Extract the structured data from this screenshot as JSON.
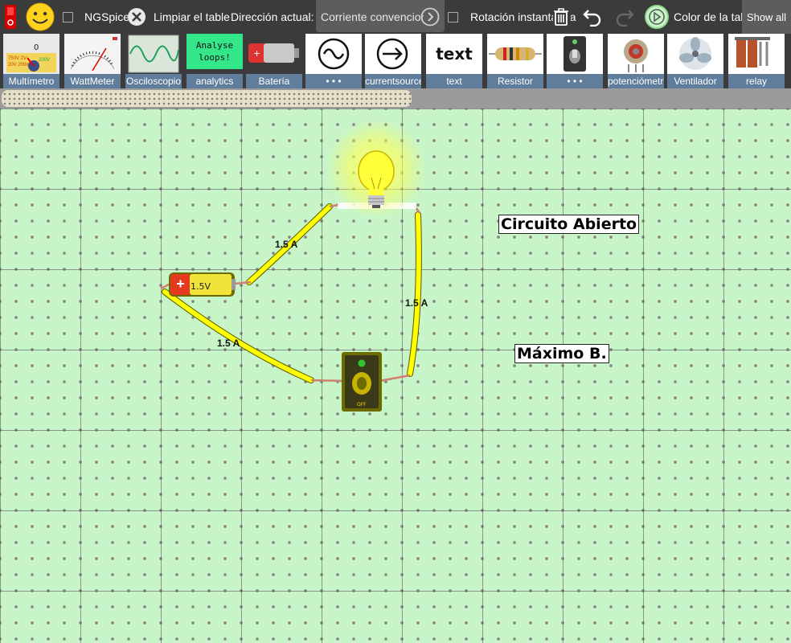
{
  "toolbar": {
    "ngspice_label": "NGSpice",
    "clear_label": "Limpiar el tablero",
    "direction_label": "Dirección actual:",
    "direction_value": "Corriente convencional",
    "rotation_label": "Rotación instantánea",
    "board_color_label": "Color de la tabla",
    "show_all_label": "Show all"
  },
  "palette": {
    "items": [
      {
        "label": "Multímetro",
        "icon": "multimeter-icon"
      },
      {
        "label": "WattMeter",
        "icon": "wattmeter-icon"
      },
      {
        "label": "Osciloscopio",
        "icon": "oscilloscope-icon"
      },
      {
        "label": "analytics",
        "icon": "analytics-icon",
        "thumb_text": "Analyse loops!"
      },
      {
        "label": "Batería",
        "icon": "battery-icon"
      },
      {
        "label": "• • •",
        "icon": "ac-source-icon"
      },
      {
        "label": "currentsource",
        "icon": "current-source-icon"
      },
      {
        "label": "text",
        "icon": "text-icon",
        "thumb_text": "text"
      },
      {
        "label": "Resistor",
        "icon": "resistor-icon"
      },
      {
        "label": "• • •",
        "icon": "toggle-switch-icon"
      },
      {
        "label": "potenciómetro",
        "icon": "potentiometer-icon"
      },
      {
        "label": "Ventilador",
        "icon": "fan-icon"
      },
      {
        "label": "relay",
        "icon": "relay-icon"
      }
    ]
  },
  "circuit": {
    "battery_label": "1.5V",
    "switch_label": "OFF",
    "currents": [
      "1.5 A",
      "1.5 A",
      "1.5 A"
    ],
    "texts": [
      "Circuito Abierto",
      "Máximo B."
    ]
  },
  "colors": {
    "board": "#c8f5c8",
    "toolbar": "#3b3b3b",
    "palette_label": "#607d9b",
    "wire": "#ffff00"
  }
}
